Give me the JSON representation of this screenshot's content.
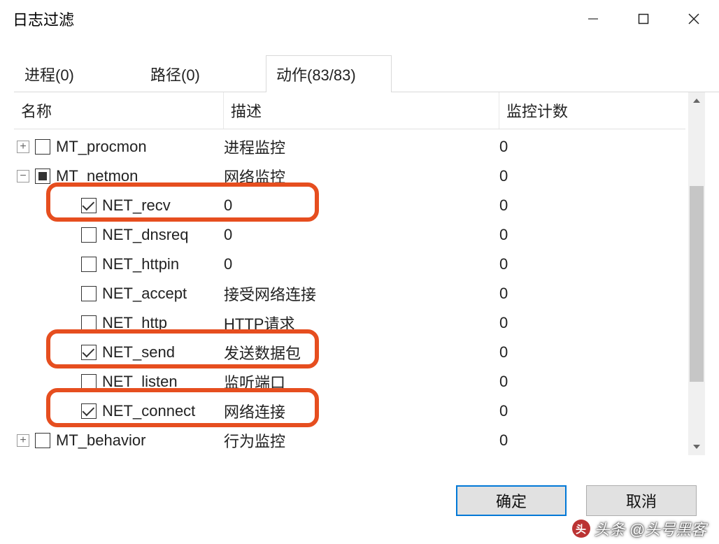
{
  "window": {
    "title": "日志过滤"
  },
  "tabs": [
    {
      "label": "进程(0)",
      "active": false
    },
    {
      "label": "路径(0)",
      "active": false
    },
    {
      "label": "动作(83/83)",
      "active": true
    }
  ],
  "columns": {
    "name": "名称",
    "desc": "描述",
    "count": "监控计数"
  },
  "rows": [
    {
      "level": 0,
      "expander": "plus",
      "check": "unchecked",
      "name": "MT_procmon",
      "desc": "进程监控",
      "count": "0",
      "hl": false
    },
    {
      "level": 0,
      "expander": "minus",
      "check": "indeterminate",
      "name": "MT_netmon",
      "desc": "网络监控",
      "count": "0",
      "hl": false
    },
    {
      "level": 1,
      "expander": "",
      "check": "checked",
      "name": "NET_recv",
      "desc": "0",
      "count": "0",
      "hl": true
    },
    {
      "level": 1,
      "expander": "",
      "check": "unchecked",
      "name": "NET_dnsreq",
      "desc": "0",
      "count": "0",
      "hl": false
    },
    {
      "level": 1,
      "expander": "",
      "check": "unchecked",
      "name": "NET_httpin",
      "desc": "0",
      "count": "0",
      "hl": false
    },
    {
      "level": 1,
      "expander": "",
      "check": "unchecked",
      "name": "NET_accept",
      "desc": "接受网络连接",
      "count": "0",
      "hl": false
    },
    {
      "level": 1,
      "expander": "",
      "check": "unchecked",
      "name": "NET_http",
      "desc": "HTTP请求",
      "count": "0",
      "hl": false
    },
    {
      "level": 1,
      "expander": "",
      "check": "checked",
      "name": "NET_send",
      "desc": "发送数据包",
      "count": "0",
      "hl": true
    },
    {
      "level": 1,
      "expander": "",
      "check": "unchecked",
      "name": "NET_listen",
      "desc": "监听端口",
      "count": "0",
      "hl": false
    },
    {
      "level": 1,
      "expander": "",
      "check": "checked",
      "name": "NET_connect",
      "desc": "网络连接",
      "count": "0",
      "hl": true
    },
    {
      "level": 0,
      "expander": "plus",
      "check": "unchecked",
      "name": "MT_behavior",
      "desc": "行为监控",
      "count": "0",
      "hl": false
    }
  ],
  "buttons": {
    "ok": "确定",
    "cancel": "取消"
  },
  "watermark": "头条 @头号黑客"
}
